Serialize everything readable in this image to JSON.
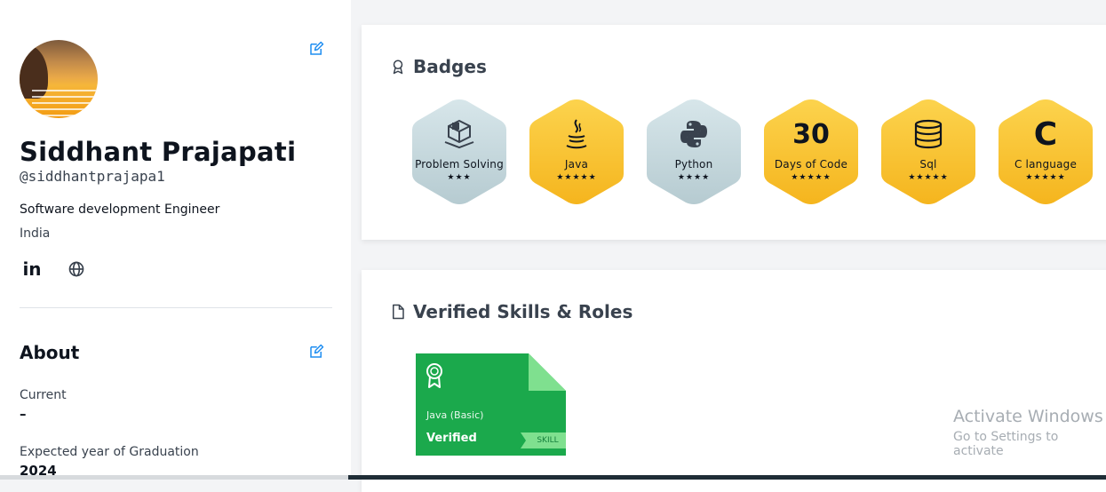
{
  "profile": {
    "name": "Siddhant Prajapati",
    "handle": "@siddhantprajapa1",
    "role": "Software development Engineer",
    "country": "India",
    "social": [
      {
        "icon": "linkedin-icon",
        "label": "in"
      },
      {
        "icon": "globe-icon"
      }
    ]
  },
  "about": {
    "title": "About",
    "current_label": "Current",
    "current_value": "–",
    "graduation_label": "Expected year of Graduation",
    "graduation_value": "2024"
  },
  "badges": {
    "title": "Badges",
    "items": [
      {
        "name": "Problem Solving",
        "stars": "★★★",
        "icon": "problem-solving-icon",
        "style": "silver"
      },
      {
        "name": "Java",
        "stars": "★★★★★",
        "icon": "java-icon",
        "style": "gold"
      },
      {
        "name": "Python",
        "stars": "★★★★",
        "icon": "python-icon",
        "style": "silver"
      },
      {
        "name": "Days of Code",
        "stars": "★★★★★",
        "icon": "30",
        "style": "gold"
      },
      {
        "name": "Sql",
        "stars": "★★★★★",
        "icon": "database-icon",
        "style": "gold"
      },
      {
        "name": "C language",
        "stars": "★★★★★",
        "icon": "C",
        "style": "gold"
      }
    ]
  },
  "skills": {
    "title": "Verified Skills & Roles",
    "items": [
      {
        "name": "Java (Basic)",
        "status": "Verified",
        "tag": "SKILL"
      }
    ]
  },
  "watermark": {
    "line1": "Activate Windows",
    "line2": "Go to Settings to activate"
  },
  "colors": {
    "gold": "#fbc02d",
    "silver": "#c3d6dc",
    "skill_green": "#1ba94c",
    "accent": "#1f8ef1"
  }
}
